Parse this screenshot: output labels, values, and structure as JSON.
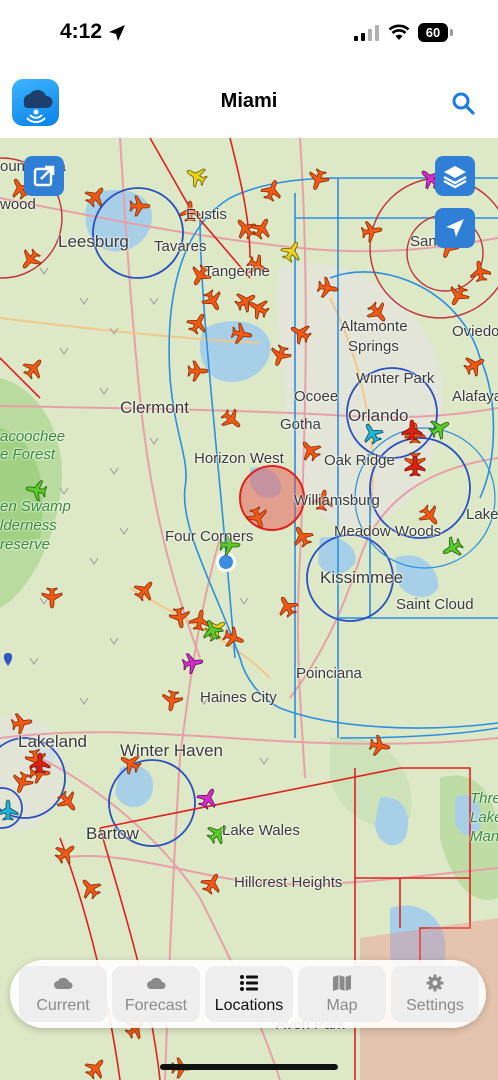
{
  "status_bar": {
    "time": "4:12",
    "battery": "60"
  },
  "header": {
    "title": "Miami"
  },
  "map_labels": {
    "leesburg": "Leesburg",
    "tavares": "Tavares",
    "eustis": "Eustis",
    "tangerine": "Tangerine",
    "sanford": "Sanford",
    "altamonte": "Altamonte",
    "springs": "Springs",
    "oviedo": "Oviedo",
    "winter_park": "Winter Park",
    "alafaya": "Alafaya",
    "clermont": "Clermont",
    "ocoee": "Ocoee",
    "gotha": "Gotha",
    "orlando": "Orlando",
    "horizon_west": "Horizon West",
    "oak_ridge": "Oak Ridge",
    "williamsburg": "Williamsburg",
    "meadow_woods": "Meadow Woods",
    "four_corners": "Four Corners",
    "kissimmee": "Kissimmee",
    "saint_cloud": "Saint Cloud",
    "poinciana": "Poinciana",
    "haines_city": "Haines City",
    "lakeland": "Lakeland",
    "winter_haven": "Winter Haven",
    "bartow": "Bartow",
    "lake_wales": "Lake Wales",
    "hillcrest_heights": "Hillcrest Heights",
    "avon_park": "Avon Park",
    "withlacoochee": "acoochee",
    "forest": "e Forest",
    "green_swamp": "en Swamp",
    "wilderness": "lderness",
    "preserve": "reserve",
    "lake_w": "Lake",
    "three": "Three",
    "lakes": "Lakes",
    "manage": "Manag",
    "wood": "wood",
    "mount_dora": "ount Dora"
  },
  "tabs": [
    {
      "label": "Current",
      "icon": "cloud-icon"
    },
    {
      "label": "Forecast",
      "icon": "cloud-icon"
    },
    {
      "label": "Locations",
      "icon": "list-icon"
    },
    {
      "label": "Map",
      "icon": "map-icon"
    },
    {
      "label": "Settings",
      "icon": "gear-icon"
    }
  ],
  "active_tab": "Locations",
  "colors": {
    "accent": "#1a7ae6",
    "airspace_class_b": "#2b8fe0",
    "airspace_class_d": "#2a4fc0",
    "restricted": "#e02020",
    "aircraft": "#f05a14",
    "aircraft_yellow": "#e8d21e",
    "aircraft_green": "#5acc2a",
    "aircraft_magenta": "#d52cc7",
    "aircraft_cyan": "#20b4d4"
  }
}
